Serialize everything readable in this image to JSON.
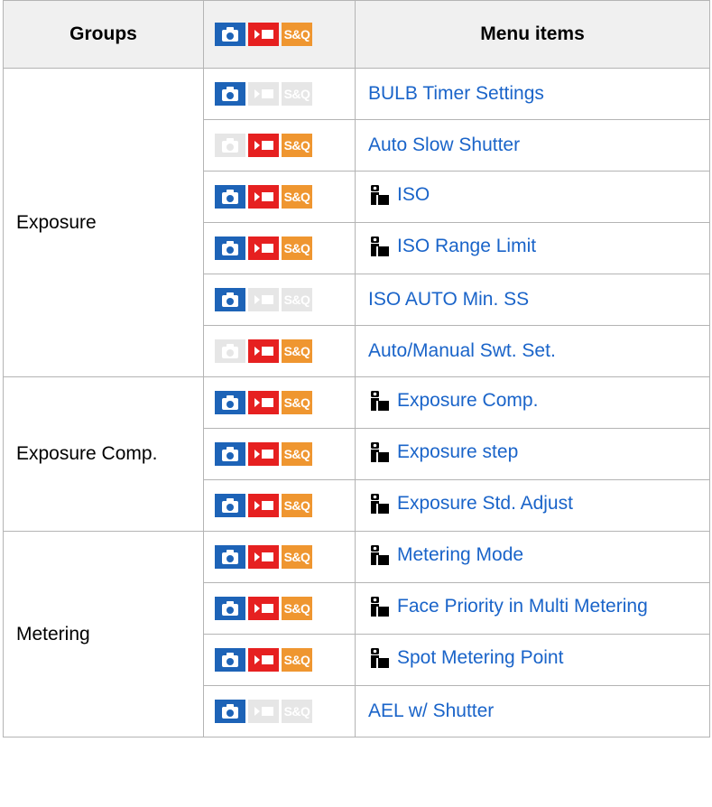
{
  "header": {
    "groups": "Groups",
    "menu_items": "Menu items",
    "mode_sq_label": "S&Q"
  },
  "groups": [
    {
      "name": "Exposure",
      "rows": [
        {
          "item": "BULB Timer Settings",
          "icon": false,
          "modes": {
            "photo": true,
            "movie": false,
            "sq": false
          }
        },
        {
          "item": "Auto Slow Shutter",
          "icon": false,
          "modes": {
            "photo": false,
            "movie": true,
            "sq": true
          }
        },
        {
          "item": "ISO",
          "icon": true,
          "modes": {
            "photo": true,
            "movie": true,
            "sq": true
          }
        },
        {
          "item": "ISO Range Limit",
          "icon": true,
          "modes": {
            "photo": true,
            "movie": true,
            "sq": true
          }
        },
        {
          "item": "ISO AUTO Min. SS",
          "icon": false,
          "modes": {
            "photo": true,
            "movie": false,
            "sq": false
          }
        },
        {
          "item": "Auto/Manual Swt. Set.",
          "icon": false,
          "modes": {
            "photo": false,
            "movie": true,
            "sq": true
          }
        }
      ]
    },
    {
      "name": "Exposure Comp.",
      "rows": [
        {
          "item": "Exposure Comp.",
          "icon": true,
          "modes": {
            "photo": true,
            "movie": true,
            "sq": true
          }
        },
        {
          "item": "Exposure step",
          "icon": true,
          "modes": {
            "photo": true,
            "movie": true,
            "sq": true
          }
        },
        {
          "item": "Exposure Std. Adjust",
          "icon": true,
          "modes": {
            "photo": true,
            "movie": true,
            "sq": true
          }
        }
      ]
    },
    {
      "name": "Metering",
      "rows": [
        {
          "item": "Metering Mode",
          "icon": true,
          "modes": {
            "photo": true,
            "movie": true,
            "sq": true
          }
        },
        {
          "item": "Face Priority in Multi Metering",
          "icon": true,
          "modes": {
            "photo": true,
            "movie": true,
            "sq": true
          }
        },
        {
          "item": "Spot Metering Point",
          "icon": true,
          "modes": {
            "photo": true,
            "movie": true,
            "sq": true
          }
        },
        {
          "item": "AEL w/ Shutter",
          "icon": false,
          "modes": {
            "photo": true,
            "movie": false,
            "sq": false
          }
        }
      ]
    }
  ],
  "colors": {
    "photo": "#1d63b7",
    "movie": "#e62020",
    "sq": "#ef9630",
    "disabled": "#e6e6e6",
    "link": "#1a64c9",
    "border": "#b4b4b4",
    "header_bg": "#f0f0f0"
  }
}
